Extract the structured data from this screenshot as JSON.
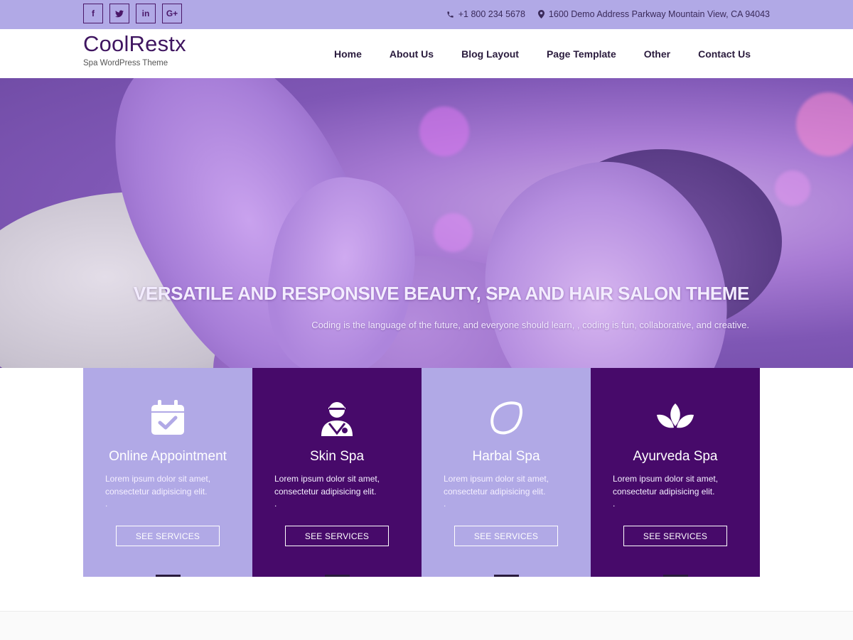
{
  "topbar": {
    "social": [
      {
        "label": "f",
        "icon": "facebook-icon"
      },
      {
        "label": "t",
        "icon": "twitter-icon"
      },
      {
        "label": "in",
        "icon": "linkedin-icon"
      },
      {
        "label": "G+",
        "icon": "googleplus-icon"
      }
    ],
    "phone": "+1 800 234 5678",
    "address": "1600 Demo Address Parkway Mountain View, CA 94043"
  },
  "header": {
    "logo": "CoolRestx",
    "tagline": "Spa WordPress Theme",
    "menu": [
      "Home",
      "About Us",
      "Blog Layout",
      "Page Template",
      "Other",
      "Contact Us"
    ]
  },
  "hero": {
    "title": "VERSATILE AND RESPONSIVE BEAUTY, SPA AND HAIR SALON THEME",
    "subtitle": "Coding is the language of the future, and everyone should learn, , coding is fun, collaborative, and creative."
  },
  "cards": [
    {
      "title": "Online Appointment",
      "text": "Lorem ipsum dolor sit amet, consectetur adipisicing elit.",
      "dot": ".",
      "button": "SEE SERVICES",
      "icon": "calendar-check-icon"
    },
    {
      "title": "Skin Spa",
      "text": "Lorem ipsum dolor sit amet, consectetur adipisicing elit.",
      "dot": ".",
      "button": "SEE SERVICES",
      "icon": "user-icon"
    },
    {
      "title": "Harbal Spa",
      "text": "Lorem ipsum dolor sit amet, consectetur adipisicing elit.",
      "dot": ".",
      "button": "SEE SERVICES",
      "icon": "lemon-icon"
    },
    {
      "title": "Ayurveda Spa",
      "text": "Lorem ipsum dolor sit amet, consectetur adipisicing elit.",
      "dot": ".",
      "button": "SEE SERVICES",
      "icon": "lotus-icon"
    }
  ],
  "colors": {
    "accent_light": "#b1a9e6",
    "accent_dark": "#470a6a",
    "logo": "#3f1560"
  }
}
